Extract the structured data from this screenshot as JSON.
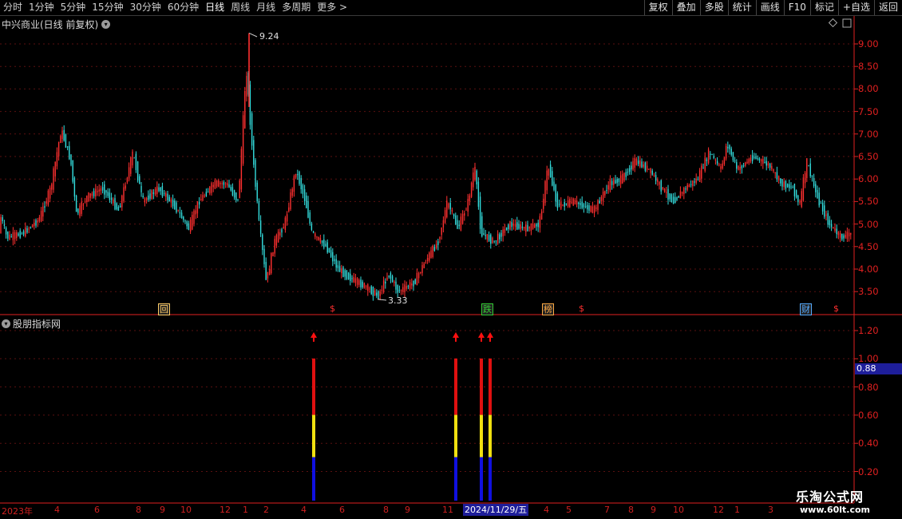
{
  "toolbar": {
    "periods": [
      "分时",
      "1分钟",
      "5分钟",
      "15分钟",
      "30分钟",
      "60分钟",
      "日线",
      "周线",
      "月线",
      "多周期",
      "更多 >"
    ],
    "active_period": "日线",
    "actions": [
      "复权",
      "叠加",
      "多股",
      "统计",
      "画线",
      "F10",
      "标记",
      "+自选",
      "返回"
    ]
  },
  "price_panel": {
    "title": "中兴商业(日线 前复权)",
    "axis_labels": [
      "9.00",
      "8.50",
      "8.00",
      "7.50",
      "7.00",
      "6.50",
      "6.00",
      "5.50",
      "5.00",
      "4.50",
      "4.00",
      "3.50"
    ],
    "max_label": "9.24",
    "min_label": "3.33",
    "badges": [
      {
        "text": "回",
        "color": "#ffcc66"
      },
      {
        "text": "$",
        "color": "#ff3030"
      },
      {
        "text": "跌",
        "color": "#33cc33"
      },
      {
        "text": "榜",
        "color": "#ffaa44"
      },
      {
        "text": "$",
        "color": "#ff3030"
      },
      {
        "text": "财",
        "color": "#55aaff"
      },
      {
        "text": "$",
        "color": "#ff3030"
      }
    ]
  },
  "indicator_panel": {
    "title": "股朋指标网",
    "axis_labels": [
      "1.20",
      "1.00",
      "0.80",
      "0.60",
      "0.40",
      "0.20"
    ],
    "current_value": "0.88",
    "signal_colors": {
      "top": "#e01010",
      "mid": "#f0e010",
      "bottom": "#1010e0",
      "arrow": "#ff1010"
    }
  },
  "date_axis": {
    "year_label": "2023年",
    "month_labels": [
      "4",
      "6",
      "8",
      "9",
      "10",
      "12",
      "1",
      "2",
      "4",
      "6",
      "8",
      "9",
      "11",
      "4",
      "5",
      "7",
      "8",
      "9",
      "10",
      "12",
      "1",
      "3"
    ],
    "highlight_date": "2024/11/29/五"
  },
  "watermark": {
    "title": "乐淘公式网",
    "url": "www.60lt.com"
  },
  "colors": {
    "up": "#ff3030",
    "down": "#33dddd",
    "axis": "#e02020",
    "grid": "#5a1010"
  }
}
